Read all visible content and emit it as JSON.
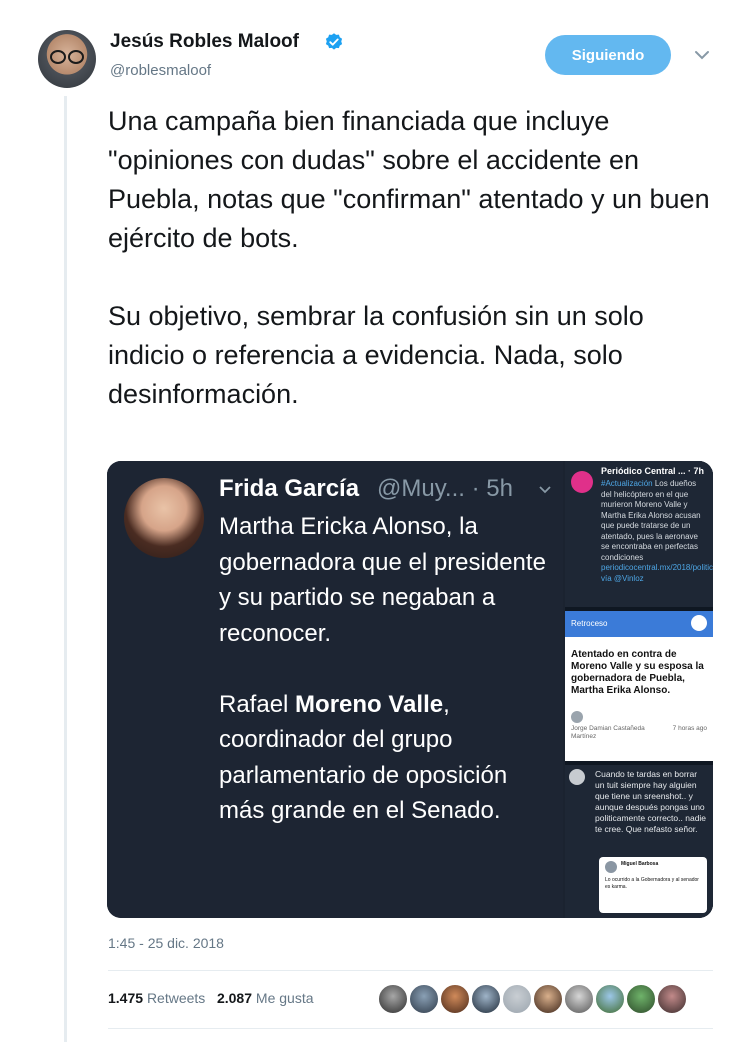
{
  "author": {
    "name": "Jesús Robles Maloof",
    "handle": "@roblesmaloof",
    "verified": true
  },
  "follow_button": {
    "label": "Siguiendo"
  },
  "tweet": {
    "paragraphs": [
      "Una campaña bien financiada que incluye \"opiniones con dudas\" sobre el accidente en Puebla, notas que \"confirman\" atentado y un buen ejército de bots.",
      "Su objetivo, sembrar la confusión sin un solo indicio o referencia a evidencia. Nada, solo desinformación."
    ]
  },
  "media": {
    "main": {
      "name": "Frida García",
      "meta": "@Muy... · 5h",
      "paragraph1": "Martha Ericka Alonso, la gobernadora que el presidente y su partido se negaban a reconocer.",
      "p2_before": "Rafael ",
      "p2_bold": "Moreno Valle",
      "p2_after": ", coordinador del grupo parlamentario de oposición más grande en el Senado."
    },
    "side1": {
      "title": "Periódico Central ... · 7h",
      "hashtag": "#Actualización",
      "text": " Los dueños del helicóptero en el que murieron Moreno Valle y Martha Erika Alonso acusan que puede tratarse de un atentado, pues la aeronave se encontraba en perfectas condiciones ",
      "link": "periodicocentral.mx/2018/politica/... vía @Vinloz"
    },
    "side2": {
      "bar_label": "Retroceso",
      "headline": "Atentado en contra de Moreno Valle y su esposa la gobernadora de Puebla, Martha Erika Alonso.",
      "author": "Jorge Damian Castañeda Martínez",
      "ago": "7 horas ago"
    },
    "side3": {
      "text": "Cuando te tardas en borrar un tuit siempre hay alguien que tiene un sreenshot.. y aunque después pongas uno politicamente correcto.. nadie te cree. Que nefasto señor.",
      "card_name": "Miguel Barbosa",
      "card_text": "Lo ocurrido a la Gobernadora y al senador es karma."
    }
  },
  "timestamp": "1:45 - 25 dic. 2018",
  "stats": {
    "retweets_count": "1.475",
    "retweets_label": "Retweets",
    "likes_count": "2.087",
    "likes_label": "Me gusta"
  },
  "colors": {
    "follow_button": "#63b8f0",
    "verified": "#1da1f2",
    "secondary_text": "#657786",
    "media_bg": "#1d2533"
  }
}
